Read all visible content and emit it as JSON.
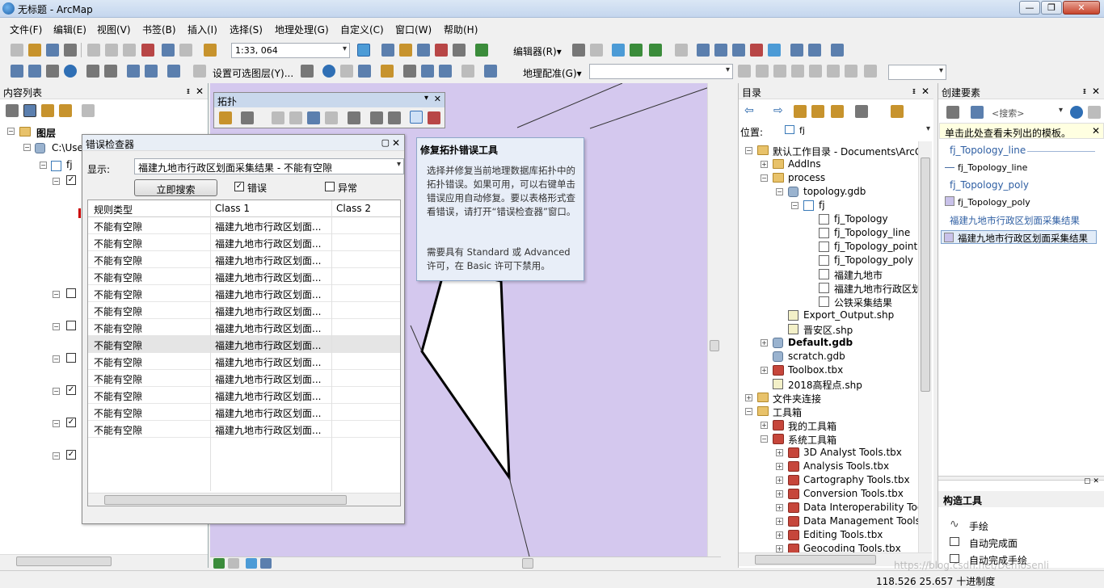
{
  "window": {
    "title": "无标题 - ArcMap",
    "controls": [
      "—",
      "❐",
      "✕"
    ]
  },
  "menu": [
    "文件(F)",
    "编辑(E)",
    "视图(V)",
    "书签(B)",
    "插入(I)",
    "选择(S)",
    "地理处理(G)",
    "自定义(C)",
    "窗口(W)",
    "帮助(H)"
  ],
  "toolbar1": {
    "scale": "1:33, 064",
    "editor": "编辑器(R)▾"
  },
  "toolbar2": {
    "select_layers": "设置可选图层(Y)...",
    "georef": "地理配准(G)▾"
  },
  "toc": {
    "title": "内容列表",
    "root": "图层",
    "path": "C:\\Use",
    "sub": "fj"
  },
  "error_inspector": {
    "title": "错误检查器",
    "show_label": "显示:",
    "show_value": "福建九地市行政区划面采集结果 - 不能有空隙",
    "search_button": "立即搜索",
    "errors_label": "错误",
    "exceptions_label": "异常",
    "columns": [
      "规则类型",
      "Class 1",
      "Class 2"
    ],
    "rows": [
      [
        "不能有空隙",
        "福建九地市行政区划面..."
      ],
      [
        "不能有空隙",
        "福建九地市行政区划面..."
      ],
      [
        "不能有空隙",
        "福建九地市行政区划面..."
      ],
      [
        "不能有空隙",
        "福建九地市行政区划面..."
      ],
      [
        "不能有空隙",
        "福建九地市行政区划面..."
      ],
      [
        "不能有空隙",
        "福建九地市行政区划面..."
      ],
      [
        "不能有空隙",
        "福建九地市行政区划面..."
      ],
      [
        "不能有空隙",
        "福建九地市行政区划面..."
      ],
      [
        "不能有空隙",
        "福建九地市行政区划面..."
      ],
      [
        "不能有空隙",
        "福建九地市行政区划面..."
      ],
      [
        "不能有空隙",
        "福建九地市行政区划面..."
      ],
      [
        "不能有空隙",
        "福建九地市行政区划面..."
      ],
      [
        "不能有空隙",
        "福建九地市行政区划面..."
      ]
    ]
  },
  "topology_toolbar": {
    "title": "拓扑"
  },
  "tooltip": {
    "title": "修复拓扑错误工具",
    "body": "选择并修复当前地理数据库拓扑中的拓扑错误。如果可用，可以右键单击错误应用自动修复。要以表格形式查看错误，请打开“错误检查器”窗口。",
    "license": "需要具有 Standard 或 Advanced 许可，在 Basic 许可下禁用。"
  },
  "catalog": {
    "title": "目录",
    "location_label": "位置:",
    "location_value": "fj",
    "items": [
      "默认工作目录 - Documents\\ArcG",
      "AddIns",
      "process",
      "topology.gdb",
      "fj",
      "fj_Topology",
      "fj_Topology_line",
      "fj_Topology_point",
      "fj_Topology_poly",
      "福建九地市",
      "福建九地市行政区划",
      "公铁采集结果",
      "Export_Output.shp",
      "晋安区.shp",
      "Default.gdb",
      "scratch.gdb",
      "Toolbox.tbx",
      "2018高程点.shp",
      "文件夹连接",
      "工具箱",
      "我的工具箱",
      "系统工具箱",
      "3D Analyst Tools.tbx",
      "Analysis Tools.tbx",
      "Cartography Tools.tbx",
      "Conversion Tools.tbx",
      "Data Interoperability Too",
      "Data Management Tools",
      "Editing Tools.tbx",
      "Geocoding Tools.tbx"
    ]
  },
  "create_features": {
    "title": "创建要素",
    "search_placeholder": "<搜索>",
    "notice": "单击此处查看未列出的模板。",
    "groups": [
      {
        "header": "fj_Topology_line",
        "item": "fj_Topology_line"
      },
      {
        "header": "fj_Topology_poly",
        "item": "fj_Topology_poly"
      },
      {
        "header": "福建九地市行政区划面采集结果",
        "item": "福建九地市行政区划面采集结果"
      }
    ],
    "tools_title": "构造工具",
    "tools": [
      "手绘",
      "自动完成面",
      "自动完成手绘"
    ]
  },
  "status": {
    "coords": "118.526  25.657 十进制度",
    "watermark": "https://blog.csdn.net/Demosenli"
  },
  "colors": {
    "map_bg": "#d4c8ee",
    "selection": "#3399ff",
    "tooltip_bg": "#e8eef8"
  }
}
